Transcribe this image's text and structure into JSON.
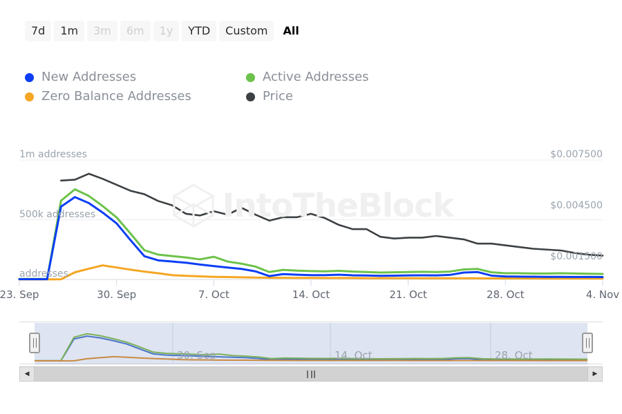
{
  "range_selector": {
    "buttons": [
      {
        "label": "7d",
        "state": "normal"
      },
      {
        "label": "1m",
        "state": "normal"
      },
      {
        "label": "3m",
        "state": "disabled"
      },
      {
        "label": "6m",
        "state": "disabled"
      },
      {
        "label": "1y",
        "state": "disabled"
      },
      {
        "label": "YTD",
        "state": "normal"
      },
      {
        "label": "Custom",
        "state": "normal"
      },
      {
        "label": "All",
        "state": "selected"
      }
    ]
  },
  "legend": {
    "items": [
      {
        "label": "New Addresses",
        "color": "#0b3ef5",
        "icon": "legend-dot-icon"
      },
      {
        "label": "Active Addresses",
        "color": "#6cc24a",
        "icon": "legend-dot-icon"
      },
      {
        "label": "Zero Balance Addresses",
        "color": "#f5a623",
        "icon": "legend-dot-icon"
      },
      {
        "label": "Price",
        "color": "#3c4043",
        "icon": "legend-dot-icon"
      }
    ]
  },
  "watermark": {
    "text": "IntoTheBlock",
    "color": "#f0f0f0"
  },
  "navigator": {
    "xticks": [
      {
        "label": "30. Sep",
        "x": 0.25
      },
      {
        "label": "14. Oct",
        "x": 0.535
      },
      {
        "label": "28. Oct",
        "x": 0.825
      }
    ],
    "scrollbar": {
      "left_arrow": "◀",
      "right_arrow": "▶",
      "grip_icon": "scrollbar-grip-icon"
    },
    "handles": {
      "left_icon": "nav-handle-left-icon",
      "right_icon": "nav-handle-right-icon"
    }
  },
  "chart_data": {
    "type": "line",
    "title": "",
    "xlabel": "",
    "ylabel": "addresses",
    "grid": true,
    "legend_position": "top-left",
    "x": [
      "23. Sep",
      "24. Sep",
      "25. Sep",
      "26. Sep",
      "27. Sep",
      "28. Sep",
      "29. Sep",
      "30. Sep",
      "1. Oct",
      "2. Oct",
      "3. Oct",
      "4. Oct",
      "5. Oct",
      "6. Oct",
      "7. Oct",
      "8. Oct",
      "9. Oct",
      "10. Oct",
      "11. Oct",
      "12. Oct",
      "13. Oct",
      "14. Oct",
      "15. Oct",
      "16. Oct",
      "17. Oct",
      "18. Oct",
      "19. Oct",
      "20. Oct",
      "21. Oct",
      "22. Oct",
      "23. Oct",
      "24. Oct",
      "25. Oct",
      "26. Oct",
      "27. Oct",
      "28. Oct",
      "29. Oct",
      "30. Oct",
      "31. Oct",
      "1. Nov",
      "2. Nov",
      "3. Nov",
      "4. Nov"
    ],
    "axes": {
      "left": {
        "label_suffix": "addresses",
        "ticks": [
          {
            "value": 0,
            "label": "addresses"
          },
          {
            "value": 500000,
            "label": "500k addresses"
          },
          {
            "value": 1000000,
            "label": "1m addresses"
          }
        ],
        "ylim": [
          0,
          1000000
        ]
      },
      "right": {
        "ticks": [
          {
            "value": 0.0015,
            "label": "$0.001500"
          },
          {
            "value": 0.0045,
            "label": "$0.004500"
          },
          {
            "value": 0.0075,
            "label": "$0.007500"
          }
        ],
        "ylim": [
          0.0005,
          0.0075
        ]
      }
    },
    "xticks": [
      "23. Sep",
      "30. Sep",
      "7. Oct",
      "14. Oct",
      "21. Oct",
      "28. Oct",
      "4. Nov"
    ],
    "series": [
      {
        "name": "New Addresses",
        "color": "#0b3ef5",
        "axis": "left",
        "unit": "addresses",
        "values": [
          2000,
          2000,
          2000,
          610000,
          690000,
          640000,
          560000,
          470000,
          330000,
          195000,
          160000,
          150000,
          140000,
          125000,
          112000,
          100000,
          88000,
          68000,
          28000,
          45000,
          40000,
          36000,
          36000,
          40000,
          35000,
          33000,
          30000,
          32000,
          34000,
          35000,
          34000,
          38000,
          58000,
          62000,
          32000,
          25000,
          24000,
          23000,
          22000,
          22000,
          21000,
          21000,
          20000
        ]
      },
      {
        "name": "Active Addresses",
        "color": "#6cc24a",
        "axis": "left",
        "unit": "addresses",
        "values": [
          4000,
          4000,
          4000,
          660000,
          755000,
          700000,
          615000,
          520000,
          385000,
          245000,
          208000,
          196000,
          184000,
          168000,
          190000,
          150000,
          132000,
          108000,
          62000,
          80000,
          74000,
          70000,
          68000,
          72000,
          66000,
          62000,
          58000,
          60000,
          62000,
          64000,
          62000,
          66000,
          84000,
          88000,
          60000,
          52000,
          52000,
          50000,
          50000,
          52000,
          50000,
          48000,
          46000
        ]
      },
      {
        "name": "Zero Balance Addresses",
        "color": "#f5a623",
        "axis": "left",
        "unit": "addresses",
        "values": [
          1000,
          1000,
          1000,
          1500,
          60000,
          90000,
          118000,
          100000,
          82000,
          66000,
          52000,
          36000,
          30000,
          26000,
          22000,
          20000,
          18000,
          16000,
          14000,
          14000,
          13000,
          13000,
          12000,
          12000,
          12000,
          11000,
          11000,
          11000,
          11000,
          10000,
          10000,
          10000,
          10000,
          10000,
          9000,
          9000,
          9000,
          9000,
          8000,
          8000,
          8000,
          8000,
          8000
        ]
      },
      {
        "name": "Price",
        "color": "#3c4043",
        "axis": "right",
        "unit": "USD",
        "values": [
          null,
          null,
          null,
          0.0063,
          0.00635,
          0.0067,
          0.0064,
          0.00605,
          0.0057,
          0.0055,
          0.0051,
          0.00485,
          0.00435,
          0.00425,
          0.0045,
          0.0043,
          0.0047,
          0.0043,
          0.00395,
          0.00415,
          0.00415,
          0.00435,
          0.0041,
          0.0037,
          0.00345,
          0.00345,
          0.003,
          0.0029,
          0.00295,
          0.00295,
          0.00305,
          0.00295,
          0.00285,
          0.0026,
          0.0026,
          0.0025,
          0.0024,
          0.0023,
          0.00225,
          0.0022,
          0.00205,
          0.00195,
          0.0019
        ]
      }
    ],
    "navigator_series": [
      {
        "name": "New Addresses",
        "color": "#4a74c8"
      },
      {
        "name": "Active Addresses",
        "color": "#7ab05a"
      },
      {
        "name": "Zero Balance Addresses",
        "color": "#c98a44"
      }
    ]
  }
}
